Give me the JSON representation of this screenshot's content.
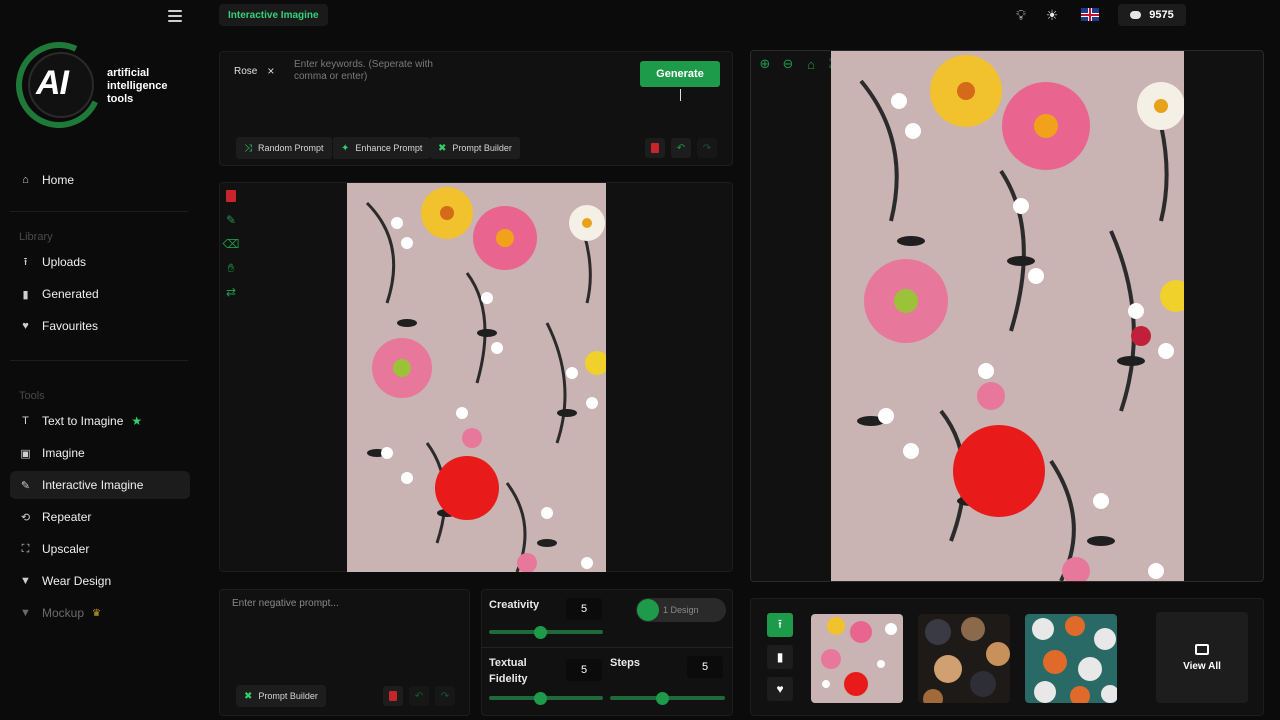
{
  "sidebar": {
    "logo": {
      "mark": "AI",
      "line1": "artificial",
      "line2": "intelligence",
      "line3": "tools"
    },
    "home": "Home",
    "library_label": "Library",
    "library": [
      {
        "label": "Uploads",
        "icon": "upload-icon"
      },
      {
        "label": "Generated",
        "icon": "bookmark-icon"
      },
      {
        "label": "Favourites",
        "icon": "heart-icon"
      }
    ],
    "tools_label": "Tools",
    "tools": [
      {
        "label": "Text to Imagine",
        "icon": "text-icon"
      },
      {
        "label": "Imagine",
        "icon": "image-icon"
      },
      {
        "label": "Interactive Imagine",
        "icon": "brush-icon"
      },
      {
        "label": "Repeater",
        "icon": "repeat-icon"
      },
      {
        "label": "Upscaler",
        "icon": "expand-icon"
      },
      {
        "label": "Wear Design",
        "icon": "shirt-icon"
      },
      {
        "label": "Mockup",
        "icon": "shirt-icon"
      }
    ]
  },
  "header": {
    "active_tab": "Interactive Imagine",
    "credits": "9575"
  },
  "prompt": {
    "chip": "Rose",
    "keywords_placeholder": "Enter keywords. (Seperate with comma or enter)",
    "generate": "Generate",
    "random": "Random Prompt",
    "enhance": "Enhance Prompt",
    "builder": "Prompt Builder"
  },
  "negative": {
    "placeholder": "Enter negative prompt...",
    "builder": "Prompt Builder"
  },
  "settings": {
    "creativity_label": "Creativity",
    "creativity": "5",
    "creativity_level": 0.45,
    "designs": "1 Design",
    "fidelity_label_1": "Textual",
    "fidelity_label_2": "Fidelity",
    "fidelity": "5",
    "fidelity_level": 0.45,
    "steps_label": "Steps",
    "steps": "5",
    "steps_level": 0.45
  },
  "gallery": {
    "view_all": "View All"
  },
  "colors": {
    "accent": "#1e9b4a",
    "accent_text": "#33d17a",
    "background": "#0b0b0b",
    "canvas": "#c9b3b3"
  }
}
